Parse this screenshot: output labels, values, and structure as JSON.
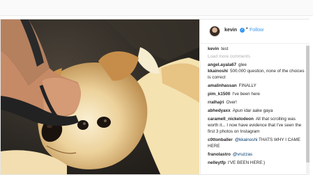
{
  "post": {
    "username": "kevin",
    "follow_label": "Follow",
    "dot": "•",
    "verified_glyph": "✓",
    "caption_user": "kevin",
    "caption_text": "test",
    "load_more": "Load more comments",
    "comments": [
      {
        "user": "angel.ayala67",
        "text": "glee"
      },
      {
        "user": "kkainoshi",
        "text": "500.000 question, none of the choices is correct"
      },
      {
        "user": "amalinhassan",
        "text": "FINALLY"
      },
      {
        "user": "pim_k1500",
        "text": "I've been here"
      },
      {
        "user": "rralhajri",
        "text": "Over!"
      },
      {
        "user": "abhedyaxx",
        "text": "Apun idar aake gaya"
      },
      {
        "user": "caramell_nickelodeon",
        "text": "All that scrolling was worth it... I now have evidence that I've seen the first 3 photos on Instagram"
      },
      {
        "user": "c0ttonballer",
        "mention": "@kkainoshi",
        "text": "THATS WHY I CAME HERE"
      },
      {
        "user": "franolastro",
        "mention": "@vruzzas",
        "text": ""
      },
      {
        "user": "nelleytfp",
        "text": "I'VE BEEN HERE:)"
      }
    ]
  },
  "colors": {
    "link_blue": "#3897f0",
    "mention_blue": "#003569",
    "muted_gray": "#b0b0b0"
  }
}
